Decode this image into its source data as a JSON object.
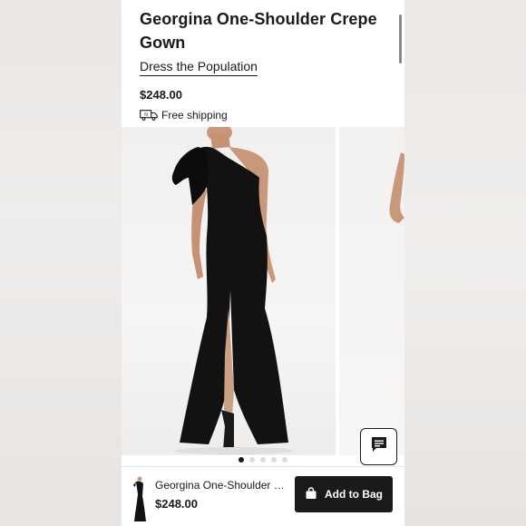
{
  "product": {
    "title": "Georgina One-Shoulder Crepe Gown",
    "brand": "Dress the Population",
    "price": "$248.00",
    "shipping": "Free shipping"
  },
  "gallery": {
    "slide_count": 5,
    "active_slide": 1
  },
  "bottom_bar": {
    "product_name": "Georgina One-Shoulder Cre...",
    "price": "$248.00",
    "add_button_label": "Add to Bag"
  },
  "icons": {
    "shipping": "truck-icon",
    "chat": "chat-icon",
    "bag": "shopping-bag-icon"
  },
  "colors": {
    "primary": "#191a1b",
    "background": "#ffffff"
  }
}
